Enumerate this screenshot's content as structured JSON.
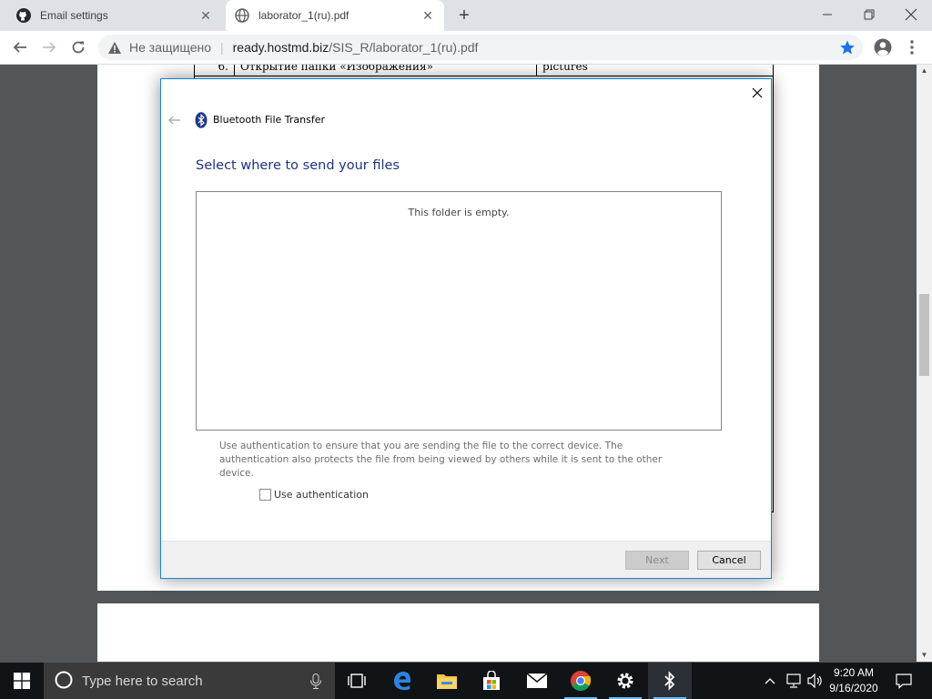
{
  "browser": {
    "tabs": [
      {
        "title": "Email settings",
        "favicon": "github-icon",
        "active": false
      },
      {
        "title": "laborator_1(ru).pdf",
        "favicon": "globe-icon",
        "active": true
      }
    ],
    "address": {
      "security_label": "Не защищено",
      "url_host": "ready.hostmd.biz",
      "url_path": "/SIS_R/laborator_1(ru).pdf"
    }
  },
  "pdf": {
    "visible_row": {
      "number": "6.",
      "action": "Открытие папки «Изображения»",
      "command": "pictures"
    }
  },
  "dialog": {
    "app_title": "Bluetooth File Transfer",
    "heading": "Select where to send your files",
    "empty_message": "This folder is empty.",
    "auth_description": "Use authentication to ensure that you are sending the file to the correct device. The authentication also protects the file from being viewed by others while it is sent to the other device.",
    "auth_checkbox_label": "Use authentication",
    "auth_checked": false,
    "next_label": "Next",
    "next_enabled": false,
    "cancel_label": "Cancel"
  },
  "taskbar": {
    "search_placeholder": "Type here to search",
    "pinned": [
      "task-view-icon",
      "edge-icon",
      "file-explorer-icon",
      "store-icon",
      "mail-icon",
      "chrome-icon",
      "settings-icon",
      "bluetooth-icon"
    ],
    "clock_time": "9:20 AM",
    "clock_date": "9/16/2020"
  },
  "colors": {
    "dialog_heading": "#1e3287",
    "dialog_border": "#1883d7",
    "bookmark_star": "#1a73e8",
    "taskbar_bg": "#101417"
  }
}
